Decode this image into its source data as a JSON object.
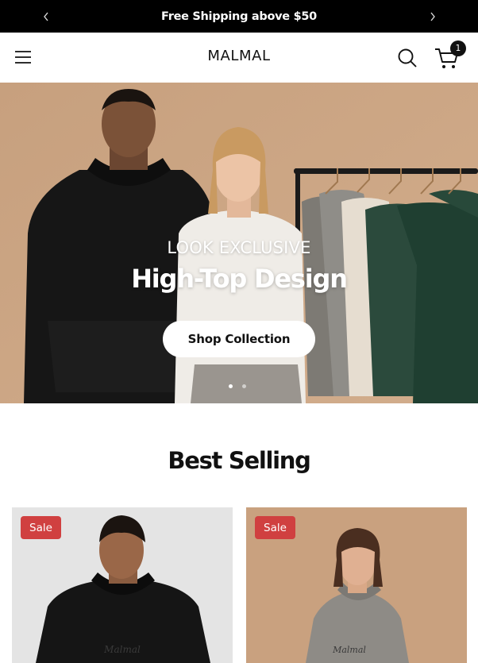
{
  "announcement": {
    "text": "Free Shipping above $50",
    "prev_icon": "chevron-left-icon",
    "next_icon": "chevron-right-icon"
  },
  "header": {
    "menu_icon": "hamburger-menu-icon",
    "logo": "MALMAL",
    "search_icon": "search-icon",
    "cart_icon": "shopping-cart-icon",
    "cart_count": "1"
  },
  "hero": {
    "eyebrow": "LOOK EXCLUSIVE",
    "headline": "High-Top Design",
    "cta_label": "Shop Collection",
    "slide_count": 2,
    "active_slide": 1
  },
  "best_selling": {
    "title": "Best Selling",
    "products": [
      {
        "badge": "Sale",
        "print": "Malmal",
        "image": "man in black hoodie"
      },
      {
        "badge": "Sale",
        "print": "Malmal",
        "image": "woman in grey hoodie"
      }
    ]
  },
  "colors": {
    "announcement_bg": "#000000",
    "hero_bg": "#c9a17f",
    "sale_badge": "#d04040",
    "card_bg_light": "#e4e4e4"
  }
}
